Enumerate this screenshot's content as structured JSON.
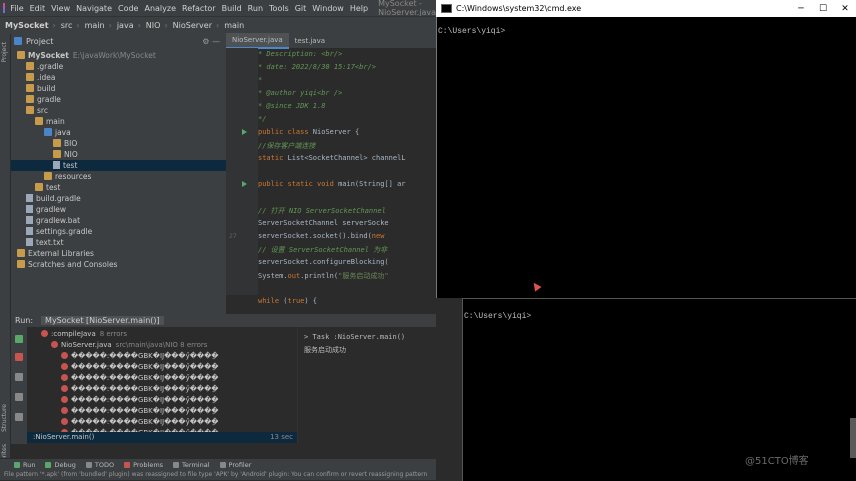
{
  "menu": {
    "app": "MySocket",
    "items": [
      "File",
      "Edit",
      "View",
      "Navigate",
      "Code",
      "Analyze",
      "Refactor",
      "Build",
      "Run",
      "Tools",
      "Git",
      "Window",
      "Help"
    ],
    "window_title": "MySocket - NioServer.java"
  },
  "nav": {
    "crumbs": [
      "MySocket",
      "src",
      "main",
      "java",
      "NIO",
      "NioServer",
      "main"
    ]
  },
  "project": {
    "header": "Project",
    "tree": [
      {
        "label": "MySocket",
        "extra": "E:\\javaWork\\MySocket",
        "indent": 0,
        "kind": "folder"
      },
      {
        "label": ".gradle",
        "indent": 1,
        "kind": "folder"
      },
      {
        "label": ".idea",
        "indent": 1,
        "kind": "folder"
      },
      {
        "label": "build",
        "indent": 1,
        "kind": "folder"
      },
      {
        "label": "gradle",
        "indent": 1,
        "kind": "folder"
      },
      {
        "label": "src",
        "indent": 1,
        "kind": "folder"
      },
      {
        "label": "main",
        "indent": 2,
        "kind": "folder"
      },
      {
        "label": "java",
        "indent": 3,
        "kind": "blue"
      },
      {
        "label": "BIO",
        "indent": 4,
        "kind": "folder"
      },
      {
        "label": "NIO",
        "indent": 4,
        "kind": "folder"
      },
      {
        "label": "test",
        "indent": 4,
        "kind": "file",
        "selected": true
      },
      {
        "label": "resources",
        "indent": 3,
        "kind": "folder"
      },
      {
        "label": "test",
        "indent": 2,
        "kind": "folder"
      },
      {
        "label": "build.gradle",
        "indent": 1,
        "kind": "file"
      },
      {
        "label": "gradlew",
        "indent": 1,
        "kind": "file"
      },
      {
        "label": "gradlew.bat",
        "indent": 1,
        "kind": "file"
      },
      {
        "label": "settings.gradle",
        "indent": 1,
        "kind": "file"
      },
      {
        "label": "text.txt",
        "indent": 1,
        "kind": "file"
      },
      {
        "label": "External Libraries",
        "indent": 0,
        "kind": "folder"
      },
      {
        "label": "Scratches and Consoles",
        "indent": 0,
        "kind": "folder"
      }
    ]
  },
  "editor": {
    "tabs": [
      "NioServer.java",
      "test.java"
    ],
    "lines": [
      {
        "n": "",
        "html": "<span class='c-com'> * Description: &lt;br/&gt;</span>"
      },
      {
        "n": "",
        "html": "<span class='c-com'> * date: 2022/8/30 15:17&lt;br/&gt;</span>"
      },
      {
        "n": "",
        "html": "<span class='c-com'> *</span>"
      },
      {
        "n": "",
        "html": "<span class='c-com'> * @author yiqi&lt;br /&gt;</span>"
      },
      {
        "n": "",
        "html": "<span class='c-com'> * @since JDK 1.8</span>"
      },
      {
        "n": "",
        "html": "<span class='c-com'> */</span>"
      },
      {
        "n": "",
        "html": "<span class='c-kw'>public class </span>NioServer {"
      },
      {
        "n": "",
        "html": "    <span class='c-com'>//保存客户端连接</span>"
      },
      {
        "n": "",
        "html": "    <span class='c-kw'>static </span>List&lt;SocketChannel&gt; channelL"
      },
      {
        "n": "",
        "html": ""
      },
      {
        "n": "",
        "html": "    <span class='c-kw'>public static void </span>main(String[] ar"
      },
      {
        "n": "",
        "html": ""
      },
      {
        "n": "",
        "html": "        <span class='c-com'>// 打开 NIO ServerSocketChannel</span>"
      },
      {
        "n": "",
        "html": "        ServerSocketChannel serverSocke"
      },
      {
        "n": "27",
        "html": "        serverSocket.socket().bind(<span class='c-kw'>new</span>"
      },
      {
        "n": "",
        "html": "        <span class='c-com'>// 设置 ServerSocketChannel 为非</span>"
      },
      {
        "n": "",
        "html": "        serverSocket.configureBlocking("
      },
      {
        "n": "",
        "html": "        System.<span class='c-kw'>out</span>.println(<span class='c-str'>\"服务启动成功\"</span>"
      },
      {
        "n": "",
        "html": ""
      },
      {
        "n": "",
        "html": "        <span class='c-kw'>while </span>(<span class='c-kw'>true</span>) {"
      }
    ]
  },
  "run": {
    "header": "Run:",
    "config": "MySocket [NioServer.main()]",
    "tree": [
      {
        "label": ":compileJava",
        "extra": "8 errors",
        "indent": 1,
        "err": true
      },
      {
        "label": "NioServer.java",
        "extra": "src\\main\\java\\NIO 8 errors",
        "indent": 2,
        "err": true
      },
      {
        "label": "�����:����GBK�Ĳ���ӳ���ַ�",
        "indent": 3,
        "err": true
      },
      {
        "label": "�����:����GBK�Ĳ���ӳ���ַ�",
        "indent": 3,
        "err": true
      },
      {
        "label": "�����:����GBK�Ĳ���ӳ���ַ�",
        "indent": 3,
        "err": true
      },
      {
        "label": "�����:����GBK�Ĳ���ӳ���ַ�",
        "indent": 3,
        "err": true
      },
      {
        "label": "�����:����GBK�Ĳ���ӳ���ַ�",
        "indent": 3,
        "err": true
      },
      {
        "label": "�����:����GBK�Ĳ���ӳ���ַ�",
        "indent": 3,
        "err": true
      },
      {
        "label": "�����:����GBK�Ĳ���ӳ���ַ�",
        "indent": 3,
        "err": true
      },
      {
        "label": "�����:����GBK�Ĳ���ӳ���ַ�",
        "indent": 3,
        "err": true
      },
      {
        "label": ":NioServer.main()",
        "extra": "13 sec",
        "indent": 0,
        "err": false
      }
    ],
    "console": [
      "> Task :NioServer.main()",
      "服务启动成功"
    ]
  },
  "bottom": {
    "tools": [
      "Run",
      "Debug",
      "TODO",
      "Problems",
      "Terminal",
      "Profiler"
    ],
    "status": "File pattern '*.apk' (from 'bundled' plugin) was reassigned to file type 'APK' by 'Android' plugin: You can confirm or revert reassigning pattern"
  },
  "cmd": {
    "title": "C:\\Windows\\system32\\cmd.exe",
    "prompt1": "C:\\Users\\yiqi>",
    "prompt2": "C:\\Users\\yiqi>"
  },
  "watermark": "@51CTO博客",
  "colors": {
    "ide_bg": "#2b2b2b",
    "panel": "#3c3f41",
    "cmd_bg": "#000000",
    "accent": "#4a88c7"
  }
}
